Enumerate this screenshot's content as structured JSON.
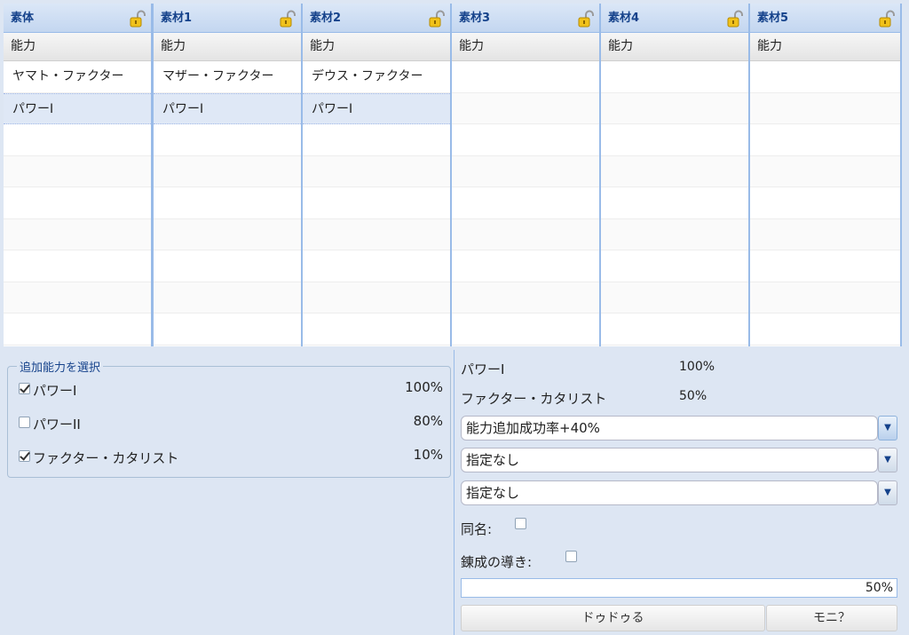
{
  "grid": {
    "columns": [
      {
        "title": "素体",
        "subheader": "能力",
        "rows": [
          "ヤマト・ファクター",
          "パワーI"
        ]
      },
      {
        "title": "素材1",
        "subheader": "能力",
        "rows": [
          "マザー・ファクター",
          "パワーI"
        ]
      },
      {
        "title": "素材2",
        "subheader": "能力",
        "rows": [
          "デウス・ファクター",
          "パワーI"
        ]
      },
      {
        "title": "素材3",
        "subheader": "能力",
        "rows": []
      },
      {
        "title": "素材4",
        "subheader": "能力",
        "rows": []
      },
      {
        "title": "素材5",
        "subheader": "能力",
        "rows": []
      }
    ],
    "lock_icon": "padlock-open-icon",
    "selected_row": 1
  },
  "additional": {
    "legend": "追加能力を選択",
    "options": [
      {
        "label": "パワーI",
        "percent": "100%",
        "checked": true
      },
      {
        "label": "パワーII",
        "percent": "80%",
        "checked": false
      },
      {
        "label": "ファクター・カタリスト",
        "percent": "10%",
        "checked": true
      }
    ]
  },
  "result": {
    "lines": [
      {
        "label": "パワーI",
        "value": "100%"
      },
      {
        "label": "ファクター・カタリスト",
        "value": "50%"
      }
    ],
    "selects": [
      "能力追加成功率+40%",
      "指定なし",
      "指定なし"
    ],
    "same_name_label": "同名:",
    "guide_label": "錬成の導き:",
    "progress_text": "50%",
    "buttons": {
      "primary": "ドゥドゥる",
      "secondary": "モニ？"
    }
  },
  "colors": {
    "header_text": "#15428b",
    "border": "#99bbe8",
    "background": "#dde6f3",
    "selected_row": "#dfe8f6"
  }
}
